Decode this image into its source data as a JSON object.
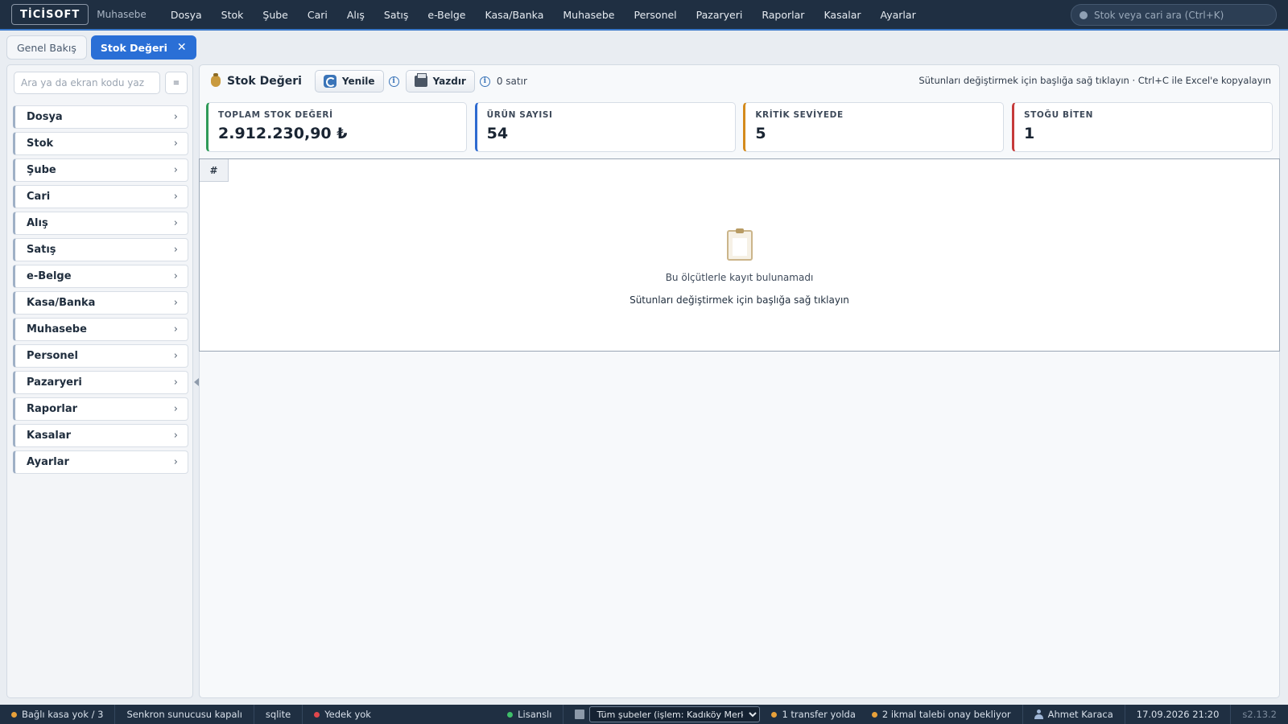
{
  "app": {
    "logo": "TİCİSOFT",
    "module": "Muhasebe",
    "nav": [
      "Dosya",
      "Stok",
      "Şube",
      "Cari",
      "Alış",
      "Satış",
      "e-Belge",
      "Kasa/Banka",
      "Muhasebe",
      "Personel",
      "Pazaryeri",
      "Raporlar",
      "Kasalar",
      "Ayarlar"
    ],
    "search_placeholder": "Stok veya cari ara (Ctrl+K)"
  },
  "tabs": {
    "overview": "Genel Bakış",
    "active": "Stok Değeri",
    "close_glyph": "✕"
  },
  "sidebar": {
    "search_placeholder": "Ara ya da ekran kodu yaz",
    "menu_btn_glyph": "≡",
    "items": [
      "Dosya",
      "Stok",
      "Şube",
      "Cari",
      "Alış",
      "Satış",
      "e-Belge",
      "Kasa/Banka",
      "Muhasebe",
      "Personel",
      "Pazaryeri",
      "Raporlar",
      "Kasalar",
      "Ayarlar"
    ],
    "chevron": "›"
  },
  "toolbar": {
    "title": "Stok Değeri",
    "refresh_label": "Yenile",
    "print_label": "Yazdır",
    "info_glyph": "i",
    "row_count": "0 satır",
    "hint": "Sütunları değiştirmek için başlığa sağ tıklayın · Ctrl+C ile Excel'e kopyalayın"
  },
  "cards": [
    {
      "label": "TOPLAM STOK DEĞERİ",
      "value": "2.912.230,90 ₺",
      "color": "#2e9a58"
    },
    {
      "label": "ÜRÜN SAYISI",
      "value": "54",
      "color": "#2d6ad0"
    },
    {
      "label": "KRİTİK SEVİYEDE",
      "value": "5",
      "color": "#d48a1c"
    },
    {
      "label": "STOĞU BİTEN",
      "value": "1",
      "color": "#c63a3a"
    }
  ],
  "grid": {
    "columns": [
      "#"
    ],
    "empty_title": "Bu ölçütlerle kayıt bulunamadı",
    "empty_hint": "Sütunları değiştirmek için başlığa sağ tıklayın"
  },
  "status": {
    "cash_registers": "Bağlı kasa yok / 3",
    "sync": "Senkron sunucusu kapalı",
    "db": "sqlite",
    "backup": "Yedek yok",
    "license": "Lisanslı",
    "branch": "Tüm şubeler (işlem: Kadıköy Merkez)",
    "transfer": "1 transfer yolda",
    "requests": "2 ikmal talebi onay bekliyor",
    "user": "Ahmet Karaca",
    "datetime": "17.09.2026 21:20",
    "version": "s2.13.2",
    "colors": {
      "warning": "#e8a13a",
      "error": "#e0474c",
      "ok": "#3fbf6a"
    }
  }
}
